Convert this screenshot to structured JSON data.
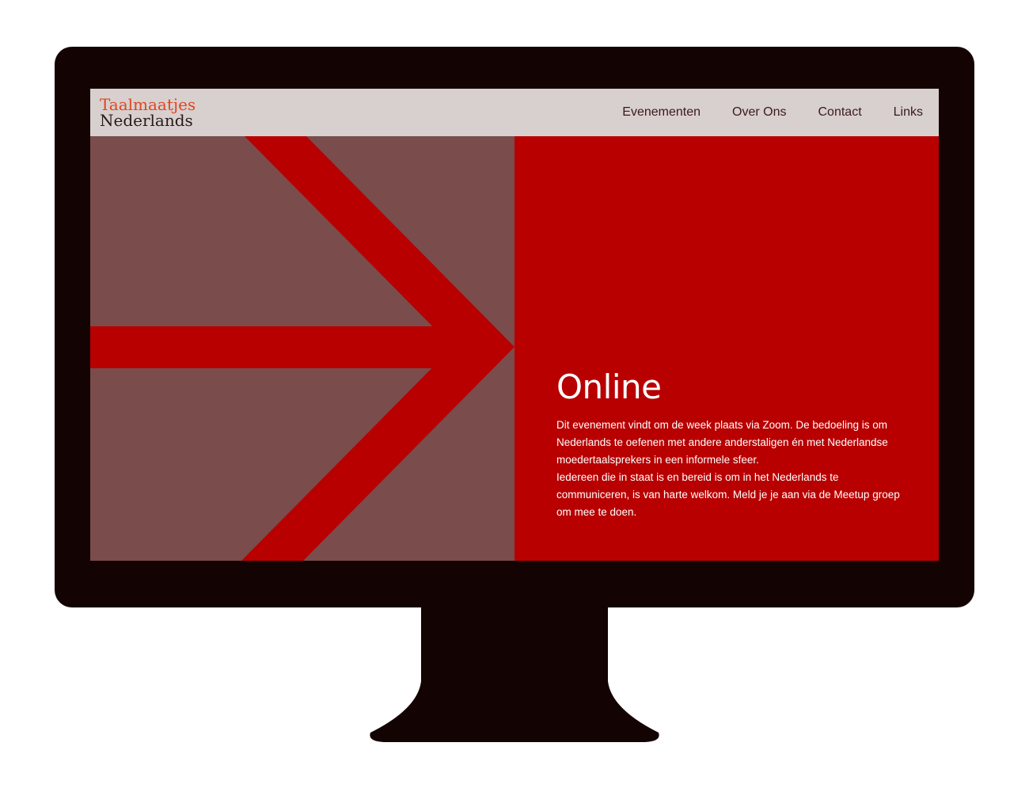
{
  "colors": {
    "brand_red": "#b80000",
    "muted_panel": "#7a4c4c",
    "nav_bg": "#d8d0cf",
    "logo_orange": "#e0461e",
    "monitor": "#140303"
  },
  "header": {
    "logo_line1": "Taalmaatjes",
    "logo_line2": "Nederlands"
  },
  "nav": {
    "items": [
      {
        "label": "Evenementen"
      },
      {
        "label": "Over Ons"
      },
      {
        "label": "Contact"
      },
      {
        "label": "Links"
      }
    ]
  },
  "hero": {
    "graphic": "arrow-right-icon",
    "title": "Online",
    "paragraph1": "Dit evenement vindt om de week plaats via Zoom. De bedoeling is om Nederlands te oefenen met andere anderstaligen én met Nederlandse moedertaalsprekers in een informele sfeer.",
    "paragraph2": "Iedereen die in staat is en bereid is om in het Nederlands te communiceren, is van harte welkom. Meld je je aan via de Meetup groep om mee te doen."
  }
}
